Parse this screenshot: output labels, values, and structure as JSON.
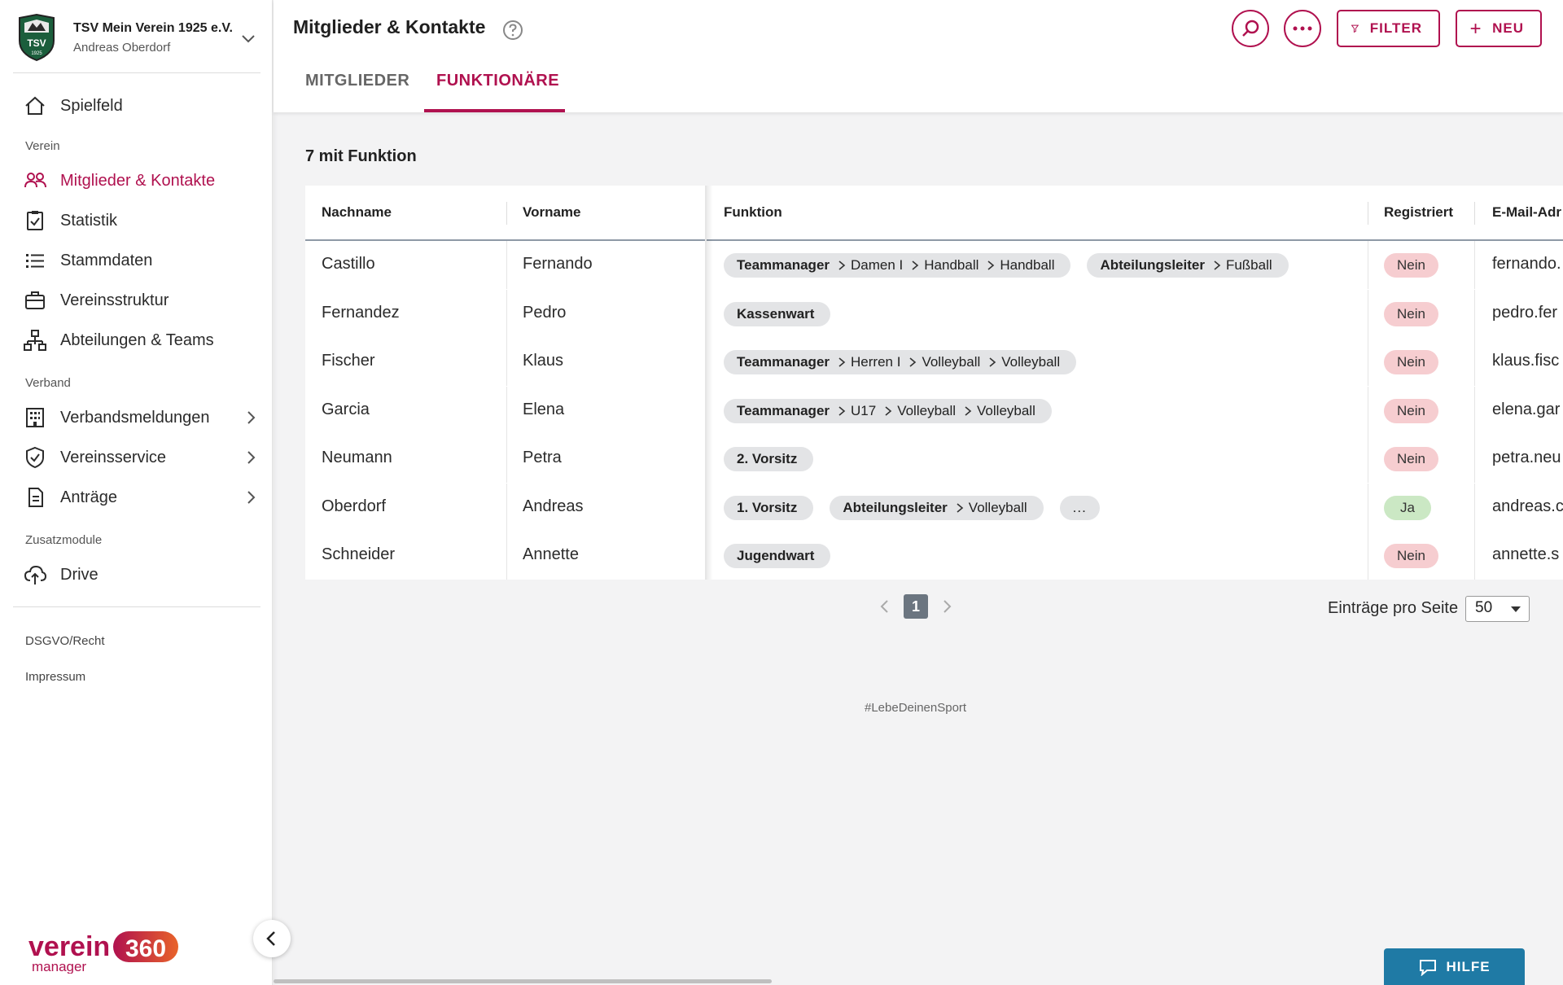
{
  "club": {
    "name": "TSV Mein Verein 1925 e.V.",
    "user": "Andreas Oberdorf",
    "logo_text": "TSV",
    "logo_year": "1925"
  },
  "nav": {
    "spielfeld": "Spielfeld",
    "section_verein": "Verein",
    "mitglieder": "Mitglieder & Kontakte",
    "statistik": "Statistik",
    "stammdaten": "Stammdaten",
    "vereinsstruktur": "Vereinsstruktur",
    "abteilungen": "Abteilungen & Teams",
    "section_verband": "Verband",
    "verbandsmeldungen": "Verbandsmeldungen",
    "vereinsservice": "Vereinsservice",
    "antraege": "Anträge",
    "section_zusatz": "Zusatzmodule",
    "drive": "Drive",
    "dsgvo": "DSGVO/Recht",
    "impressum": "Impressum"
  },
  "brand": {
    "word": "verein",
    "number": "360",
    "sub": "manager"
  },
  "header": {
    "title": "Mitglieder & Kontakte",
    "filter": "FILTER",
    "neu": "NEU"
  },
  "tabs": {
    "mitglieder": "MITGLIEDER",
    "funktionaere": "FUNKTIONÄRE"
  },
  "count_label": "7 mit Funktion",
  "table": {
    "headers": {
      "nachname": "Nachname",
      "vorname": "Vorname",
      "funktion": "Funktion",
      "registriert": "Registriert",
      "email": "E-Mail-Adr"
    },
    "rows": [
      {
        "nachname": "Castillo",
        "vorname": "Fernando",
        "registriert": "Nein",
        "email": "fernando.",
        "chips": [
          {
            "role": "Teammanager",
            "path": [
              "Damen I",
              "Handball",
              "Handball"
            ]
          },
          {
            "role": "Abteilungsleiter",
            "path": [
              "Fußball"
            ]
          }
        ]
      },
      {
        "nachname": "Fernandez",
        "vorname": "Pedro",
        "registriert": "Nein",
        "email": "pedro.fer",
        "chips": [
          {
            "role": "Kassenwart",
            "path": []
          }
        ]
      },
      {
        "nachname": "Fischer",
        "vorname": "Klaus",
        "registriert": "Nein",
        "email": "klaus.fisc",
        "chips": [
          {
            "role": "Teammanager",
            "path": [
              "Herren I",
              "Volleyball",
              "Volleyball"
            ]
          }
        ]
      },
      {
        "nachname": "Garcia",
        "vorname": "Elena",
        "registriert": "Nein",
        "email": "elena.gar",
        "chips": [
          {
            "role": "Teammanager",
            "path": [
              "U17",
              "Volleyball",
              "Volleyball"
            ]
          }
        ]
      },
      {
        "nachname": "Neumann",
        "vorname": "Petra",
        "registriert": "Nein",
        "email": "petra.neu",
        "chips": [
          {
            "role": "2. Vorsitz",
            "path": []
          }
        ]
      },
      {
        "nachname": "Oberdorf",
        "vorname": "Andreas",
        "registriert": "Ja",
        "email": "andreas.c",
        "chips": [
          {
            "role": "1. Vorsitz",
            "path": []
          },
          {
            "role": "Abteilungsleiter",
            "path": [
              "Volleyball"
            ]
          }
        ],
        "more": "..."
      },
      {
        "nachname": "Schneider",
        "vorname": "Annette",
        "registriert": "Nein",
        "email": "annette.s",
        "chips": [
          {
            "role": "Jugendwart",
            "path": []
          }
        ]
      }
    ]
  },
  "pagination": {
    "current": "1",
    "per_page_label": "Einträge pro Seite",
    "per_page_value": "50"
  },
  "footer_tag": "#LebeDeinenSport",
  "help_button": "HILFE",
  "colors": {
    "accent": "#b0114f",
    "help": "#1f7aa5",
    "badge_no": "#f6cdd0",
    "badge_yes": "#cbe8c4"
  }
}
